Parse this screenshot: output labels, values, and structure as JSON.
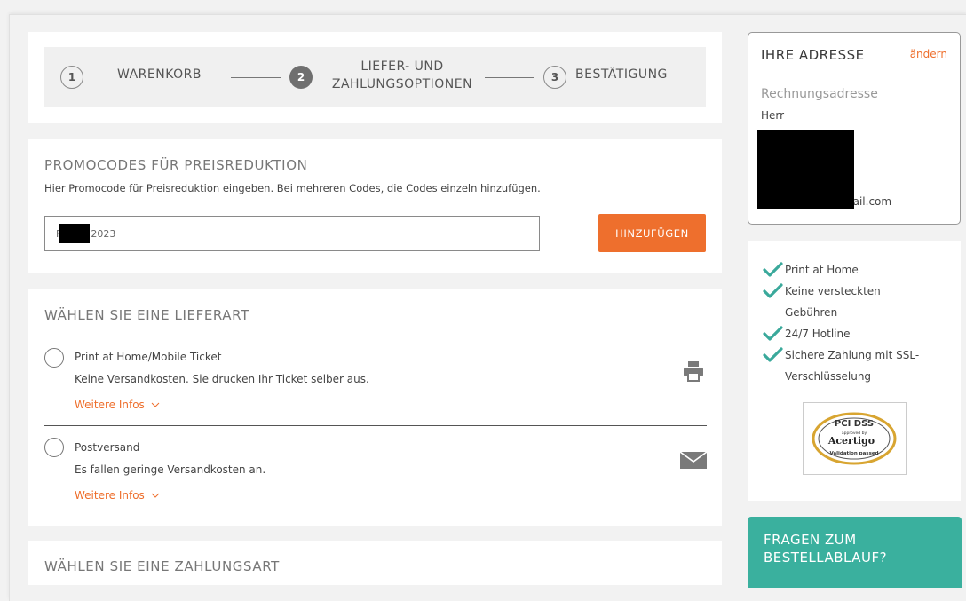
{
  "steps": [
    {
      "number": "1",
      "label": "WARENKORB"
    },
    {
      "number": "2",
      "label_line1": "LIEFER- UND",
      "label_line2": "ZAHLUNGSOPTIONEN"
    },
    {
      "number": "3",
      "label": "BESTÄTIGUNG"
    }
  ],
  "promo": {
    "title": "PROMOCODES FÜR PREISREDUKTION",
    "description": "Hier Promocode für Preisreduktion eingeben. Bei mehreren Codes, die Codes einzeln hinzufügen.",
    "input_prefix": "F",
    "input_suffix": "2023",
    "button_label": "HINZUFÜGEN"
  },
  "delivery": {
    "title": "WÄHLEN SIE EINE LIEFERART",
    "options": [
      {
        "title": "Print at Home/Mobile Ticket",
        "description": "Keine Versandkosten. Sie drucken Ihr Ticket selber aus.",
        "more": "Weitere Infos",
        "icon": "printer-icon"
      },
      {
        "title": "Postversand",
        "description": "Es fallen geringe Versandkosten an.",
        "more": "Weitere Infos",
        "icon": "envelope-icon"
      }
    ]
  },
  "payment": {
    "title": "WÄHLEN SIE EINE ZAHLUNGSART"
  },
  "address": {
    "title": "IHRE ADRESSE",
    "change_label": "ändern",
    "billing_label": "Rechnungsadresse",
    "salutation": "Herr",
    "email_visible": "nail.com"
  },
  "trust": {
    "items": [
      "Print at Home",
      "Keine versteckten Gebühren",
      "24/7 Hotline",
      "Sichere Zahlung mit SSL-Verschlüsselung"
    ],
    "badge_text_top": "PCI DSS",
    "badge_text_mid1": "approved by",
    "badge_text_mid2": "Acertigo",
    "badge_text_bottom": "Validation passed"
  },
  "faq": {
    "text": "FRAGEN ZUM BESTELLABLAUF?"
  },
  "colors": {
    "accent": "#ee6f2d",
    "teal": "#3ab09e",
    "check": "#3aa99b"
  }
}
